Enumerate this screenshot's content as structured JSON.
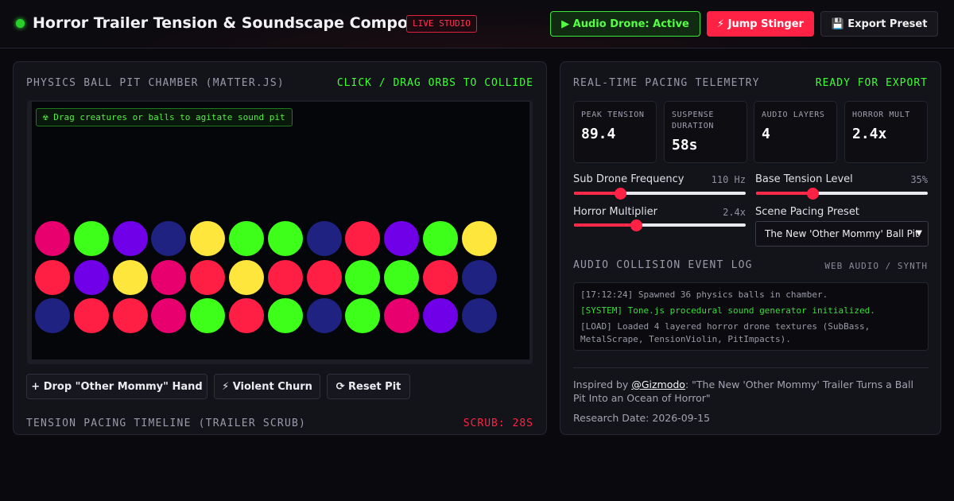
{
  "header": {
    "title": "Horror Trailer Tension & Soundscape Composer",
    "badge": "LIVE STUDIO",
    "drone_button": "▶ Audio Drone: Active",
    "jump_button": "⚡ Jump Stinger",
    "export_button": "💾 Export Preset"
  },
  "pit_panel": {
    "title": "PHYSICS BALL PIT CHAMBER (MATTER.JS)",
    "hint": "CLICK / DRAG ORBS TO COLLIDE",
    "tag": "☢ Drag creatures or balls to agitate sound pit",
    "buttons": {
      "drop": "+ Drop \"Other Mommy\" Hand",
      "churn": "⚡ Violent Churn",
      "reset": "⟳ Reset Pit"
    },
    "timeline_title": "TENSION PACING TIMELINE (TRAILER SCRUB)",
    "scrub": "SCRUB: 28S",
    "ball_rows": [
      [
        "magenta",
        "green",
        "violet",
        "navy",
        "yellow",
        "green",
        "green",
        "navy",
        "red",
        "violet",
        "green",
        "yellow"
      ],
      [
        "red",
        "violet",
        "yellow",
        "magenta",
        "red",
        "yellow",
        "red",
        "red",
        "green",
        "green",
        "red",
        "navy"
      ],
      [
        "navy",
        "red",
        "red",
        "magenta",
        "green",
        "red",
        "green",
        "navy",
        "green",
        "magenta",
        "violet",
        "navy"
      ]
    ],
    "ball_colors": {
      "magenta": "#e8006e",
      "green": "#3dff1a",
      "violet": "#7000e8",
      "navy": "#1f2280",
      "yellow": "#ffe63d",
      "red": "#ff1e44"
    }
  },
  "telemetry": {
    "title": "REAL-TIME PACING TELEMETRY",
    "status": "READY FOR EXPORT",
    "stats": [
      {
        "label": "PEAK TENSION",
        "value": "89.4"
      },
      {
        "label": "SUSPENSE DURATION",
        "value": "58s"
      },
      {
        "label": "AUDIO LAYERS",
        "value": "4"
      },
      {
        "label": "HORROR MULT",
        "value": "2.4x"
      }
    ],
    "controls": {
      "sub_drone": {
        "label": "Sub Drone Frequency",
        "value": "110 Hz",
        "fraction": 0.27
      },
      "base_tension": {
        "label": "Base Tension Level",
        "value": "35%",
        "fraction": 0.33
      },
      "horror_mult": {
        "label": "Horror Multiplier",
        "value": "2.4x",
        "fraction": 0.36
      },
      "scene_preset": {
        "label": "Scene Pacing Preset",
        "selected": "The New 'Other Mommy' Ball Pit"
      }
    }
  },
  "audio_log": {
    "title": "AUDIO COLLISION EVENT LOG",
    "tag": "WEB AUDIO / SYNTH",
    "lines": [
      "[17:12:24] Spawned 36 physics balls in chamber.",
      "[SYSTEM] Tone.js procedural sound generator initialized.",
      "[LOAD] Loaded 4 layered horror drone textures (SubBass, MetalScrape, TensionViolin, PitImpacts)."
    ]
  },
  "credit": {
    "prefix": "Inspired by ",
    "handle": "@Gizmodo",
    "quote": ": \"The New 'Other Mommy' Trailer Turns a Ball Pit Into an Ocean of Horror\"",
    "research_date": "Research Date: 2026-09-15"
  },
  "colors": {
    "accent_red": "#ff2244",
    "accent_green": "#3dff33",
    "background": "#0a0a0e"
  }
}
